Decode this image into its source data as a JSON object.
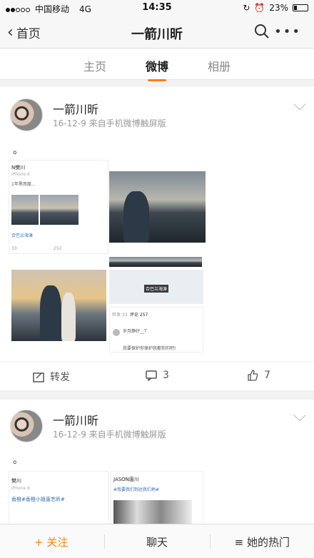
{
  "status_bar": {
    "carrier": "中国移动",
    "network": "4G",
    "time": "14:35",
    "battery": "23%"
  },
  "nav": {
    "back_label": "首页",
    "title": "一箭川昕"
  },
  "tabs": [
    {
      "label": "主页",
      "active": false
    },
    {
      "label": "微博",
      "active": true
    },
    {
      "label": "相册",
      "active": false
    }
  ],
  "posts": [
    {
      "username": "一箭川昕",
      "meta": "16-12-9   来自手机微博触屏版",
      "text": "。",
      "actions": {
        "repost_label": "转发",
        "comments": "3",
        "likes": "7"
      },
      "screenshot_a": {
        "title": "N樊川",
        "sub": "iPhone 6",
        "line": "1年黑而度...",
        "loc": "合巴兰海滩",
        "reposts": "33",
        "comments": "252"
      },
      "screenshot_b": {
        "map_label": "合巴兰海滩",
        "tab_repost": "转发 33",
        "tab_comment": "评论 257",
        "commenter": "岁月静好__T",
        "comment": "我要保护你保护我都你的吧!"
      }
    },
    {
      "username": "一箭川昕",
      "meta": "16-12-9   来自手机微博触屏版",
      "text": "。",
      "screenshot_a": {
        "title": "樊川",
        "sub": "iPhone 6",
        "line": "香橙#香橙小姐唐艺昕#"
      },
      "screenshot_b": {
        "title": "JASON唐川",
        "line": "#我要我们到达我们地#"
      }
    }
  ],
  "bottom_bar": {
    "follow_label": "+ 关注",
    "chat_label": "聊天",
    "hot_label": "≡ 她的热门"
  }
}
